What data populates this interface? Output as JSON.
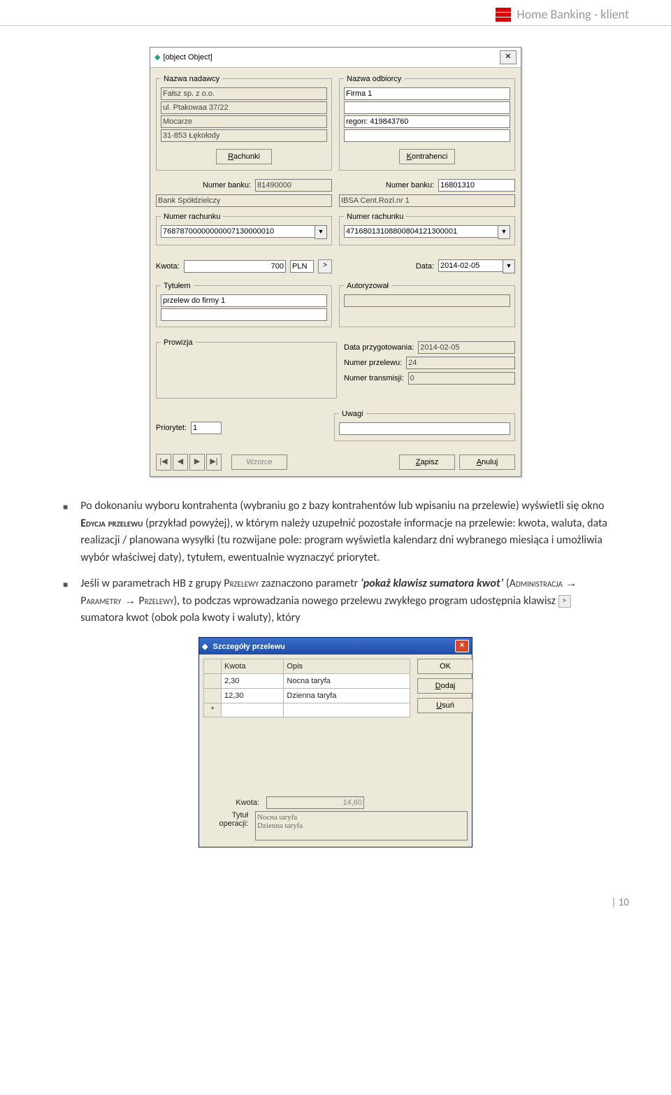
{
  "header": {
    "title": "Home Banking - klient"
  },
  "dialog1": {
    "title": {
      "legend": "Tytułem",
      "lines": [
        "przelew do firmy 1",
        ""
      ]
    },
    "close_glyph": "✕",
    "sender": {
      "legend": "Nazwa nadawcy",
      "lines": [
        "Fałsz sp. z o.o.",
        "ul. Ptakowaa 37/22",
        "Mocarze",
        "31-853 Łękołody"
      ],
      "accounts_btn": "Rachunki"
    },
    "recipient": {
      "legend": "Nazwa odbiorcy",
      "lines": [
        "Firma 1",
        "",
        "regon: 419843760",
        ""
      ],
      "contractors_btn": "Kontrahenci"
    },
    "sender_bank": {
      "numlabel": "Numer banku:",
      "num": "81490000",
      "name": "Bank Spółdzielczy"
    },
    "recip_bank": {
      "numlabel": "Numer banku:",
      "num": "16801310",
      "name": "IBSA Cent.Rozl.nr 1"
    },
    "sender_acc": {
      "legend": "Numer rachunku",
      "value": "76878700000000007130000010"
    },
    "recip_acc": {
      "legend": "Numer rachunku",
      "value": "47168013108800804121300001"
    },
    "amount": {
      "label": "Kwota:",
      "value": "700",
      "currency": "PLN",
      "sum_glyph": ">"
    },
    "date": {
      "label": "Data:",
      "value": "2014-02-05"
    },
    "auth": {
      "legend": "Autoryzował",
      "value": ""
    },
    "commission": {
      "legend": "Prowizja",
      "value": ""
    },
    "prep_date": {
      "label": "Data przygotowania:",
      "value": "2014-02-05"
    },
    "transfer_no": {
      "label": "Numer przelewu:",
      "value": "24"
    },
    "transmission_no": {
      "label": "Numer transmisji:",
      "value": "0"
    },
    "priority": {
      "label": "Priorytet:",
      "value": "1"
    },
    "notes": {
      "legend": "Uwagi",
      "value": ""
    },
    "nav": [
      "|◀",
      "◀",
      "▶",
      "▶|"
    ],
    "templates_btn": "Wzorce",
    "save_btn": "Zapisz",
    "cancel_btn": "Anuluj"
  },
  "paragraphs": {
    "p1_a": "Po dokonaniu wyboru kontrahenta (wybraniu go z bazy kontrahentów lub wpisaniu na przelewie) wyświetli się okno ",
    "p1_b": "Edycja przelewu",
    "p1_c": " (przykład powyżej), w którym należy uzupełnić pozostałe informacje na przelewie: kwota, waluta, data realizacji / planowana wysyłki (tu rozwijane pole: program wyświetla kalendarz dni wybranego miesiąca i umożliwia wybór właściwej daty), tytułem, ewentualnie wyznaczyć priorytet.",
    "p2_a": "Jeśli w parametrach HB z grupy ",
    "p2_b": "Przelewy",
    "p2_c": " zaznaczono parametr ",
    "p2_d": "‘pokaż klawisz sumatora kwot’",
    "p2_e": " (",
    "p2_f": "Administracja",
    "p2_g": " → ",
    "p2_h": "Parametry",
    "p2_i": " → ",
    "p2_j": "Przelewy",
    "p2_k": "), to podczas wprowadzania nowego przelewu zwykłego program udostępnia klawisz ",
    "p2_l": " sumatora kwot (obok pola kwoty i waluty), który",
    "sum_glyph": ">"
  },
  "dialog2": {
    "title": "Szczegóły przelewu",
    "cols": [
      "Kwota",
      "Opis"
    ],
    "rows": [
      {
        "k": "2,30",
        "o": "Nocna taryfa"
      },
      {
        "k": "12,30",
        "o": "Dzienna taryfa"
      }
    ],
    "star": "*",
    "ok": "OK",
    "add": "Dodaj",
    "del": "Usuń",
    "amount_label": "Kwota:",
    "amount_value": "14,60",
    "optitle_label": "Tytuł operacji:",
    "optitle_value": "Nocna taryfa\nDzienna taryfa"
  },
  "footer": {
    "page": "| 10"
  }
}
